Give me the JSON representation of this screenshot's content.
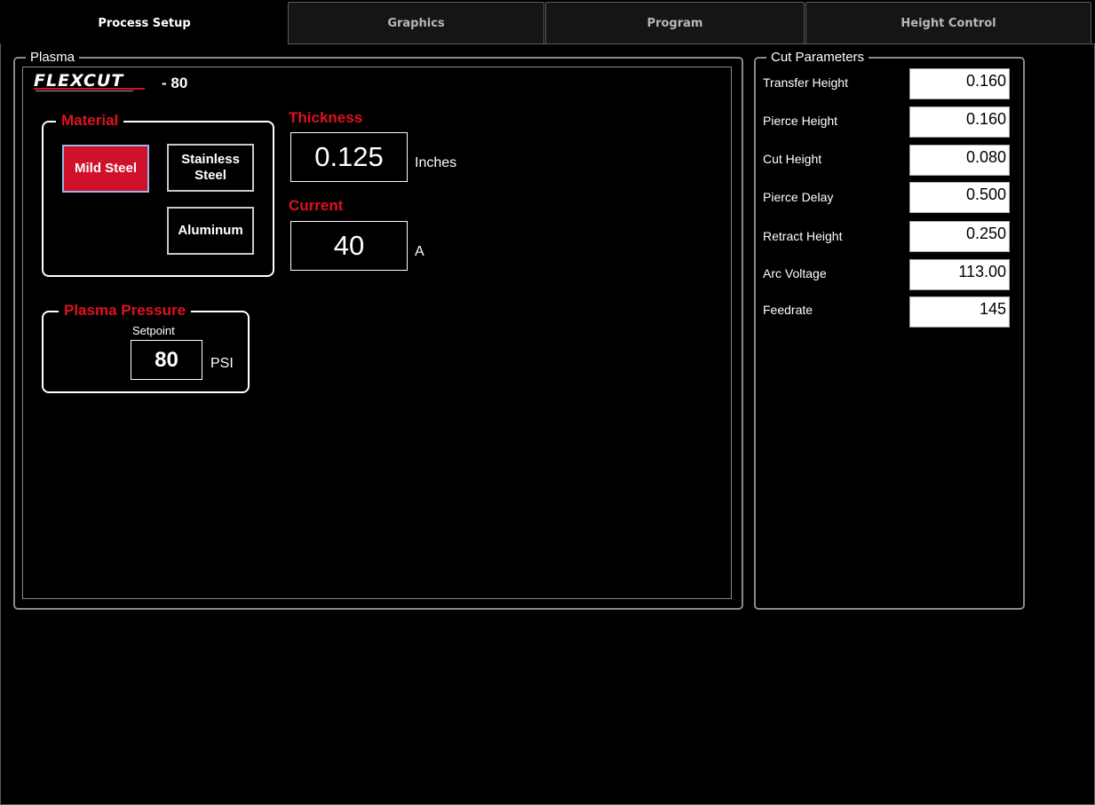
{
  "tabs": [
    {
      "label": "Process Setup",
      "active": true
    },
    {
      "label": "Graphics",
      "active": false
    },
    {
      "label": "Program",
      "active": false
    },
    {
      "label": "Height Control",
      "active": false
    }
  ],
  "plasma": {
    "legend": "Plasma",
    "logo_text": "FLEXCUT",
    "model_suffix": "- 80",
    "material": {
      "title": "Material",
      "options": [
        {
          "label": "Mild Steel",
          "selected": true
        },
        {
          "label": "Stainless Steel",
          "selected": false
        },
        {
          "label": "Aluminum",
          "selected": false
        }
      ]
    },
    "thickness": {
      "label": "Thickness",
      "value": "0.125",
      "unit": "Inches"
    },
    "current": {
      "label": "Current",
      "value": "40",
      "unit": "A"
    },
    "pressure": {
      "title": "Plasma Pressure",
      "setpoint_label": "Setpoint",
      "value": "80",
      "unit": "PSI"
    }
  },
  "cut_parameters": {
    "legend": "Cut Parameters",
    "items": [
      {
        "label": "Transfer Height",
        "value": "0.160"
      },
      {
        "label": "Pierce Height",
        "value": "0.160"
      },
      {
        "label": "Cut Height",
        "value": "0.080"
      },
      {
        "label": "Pierce Delay",
        "value": "0.500"
      },
      {
        "label": "Retract Height",
        "value": "0.250"
      },
      {
        "label": "Arc Voltage",
        "value": "113.00"
      },
      {
        "label": "Feedrate",
        "value": "145"
      }
    ]
  },
  "colors": {
    "accent_red": "#e0121f",
    "selected_button": "#d0112b",
    "background": "#000000"
  }
}
